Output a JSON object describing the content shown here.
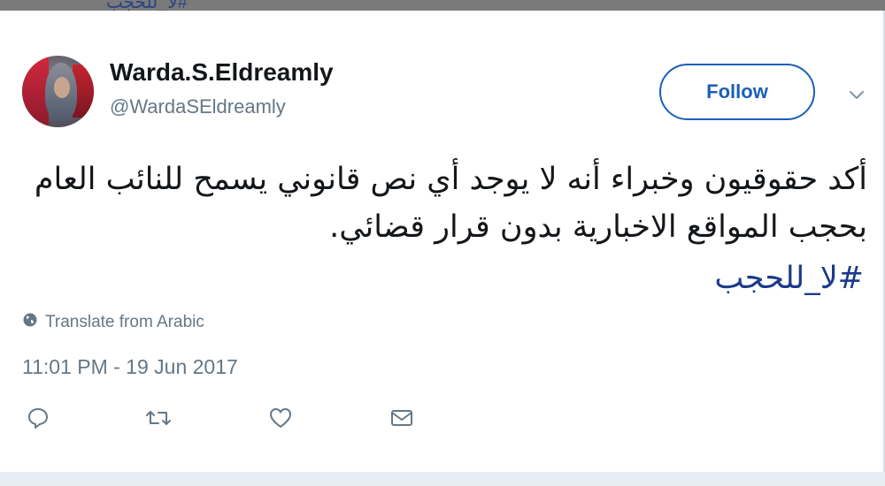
{
  "tweet": {
    "display_name": "Warda.S.Eldreamly",
    "handle": "@WardaSEldreamly",
    "follow_label": "Follow",
    "text": "أكد حقوقيون وخبراء أنه لا يوجد أي نص قانوني يسمح للنائب العام بحجب المواقع الاخبارية بدون قرار قضائي.",
    "hashtag": "#لا_للحجب",
    "translate_label": "Translate from Arabic",
    "timestamp": "11:01 PM - 19 Jun 2017"
  },
  "icons": {
    "translate": "globe-icon",
    "menu": "chevron-down-icon",
    "reply": "reply-icon",
    "retweet": "retweet-icon",
    "like": "heart-icon",
    "message": "envelope-icon"
  },
  "colors": {
    "link": "#1b3a8a",
    "button": "#1b5fb8",
    "muted": "#657786",
    "text": "#14171a"
  }
}
